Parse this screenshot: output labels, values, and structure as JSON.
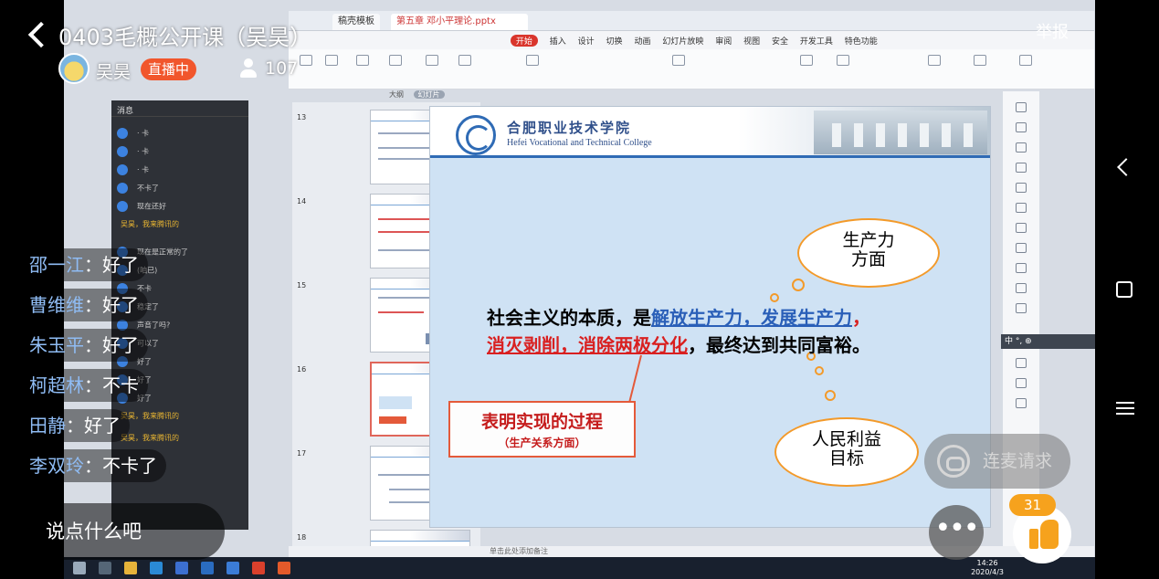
{
  "stream": {
    "title": "0403毛概公开课（吴昊）",
    "host_name": "吴昊",
    "live_badge": "直播中",
    "viewer_count": "107",
    "report_label": "举报"
  },
  "comments": [
    {
      "user": "邵一江",
      "text": "：好了"
    },
    {
      "user": "曹维维",
      "text": "：好了"
    },
    {
      "user": "朱玉平",
      "text": "：好了"
    },
    {
      "user": "柯超林",
      "text": "：不卡"
    },
    {
      "user": "田静",
      "text": "：好了"
    },
    {
      "user": "李双玲",
      "text": "：不卡了"
    }
  ],
  "input": {
    "placeholder": "说点什么吧"
  },
  "actions": {
    "cohost_label": "连麦请求",
    "like_count": "31"
  },
  "shared_screen": {
    "ppt_tab_home": "稿壳模板",
    "ppt_tab_doc": "第五章  邓小平理论.pptx",
    "ribbon_menu": [
      "开始",
      "插入",
      "设计",
      "切换",
      "动画",
      "幻灯片放映",
      "审阅",
      "视图",
      "安全",
      "开发工具",
      "特色功能"
    ],
    "subtabs": [
      "大纲",
      "幻灯片"
    ],
    "thumb_numbers": [
      "13",
      "14",
      "15",
      "16",
      "17",
      "18"
    ],
    "msg_panel_head": "消息",
    "notes_hint": "单击此处添加备注",
    "lang_bar": "中 °, ⊕",
    "clock_time": "14:26",
    "clock_date": "2020/4/3"
  },
  "slide": {
    "college_cn": "合肥职业技术学院",
    "college_en": "Hefei Vocational and Technical College",
    "cloud_top": [
      "生产力",
      "方面"
    ],
    "cloud_bottom": [
      "人民利益",
      "目标"
    ],
    "line1_prefix": "社会主义的本质，是",
    "line1_highlight": "解放生产力，发展生产力",
    "line1_suffix": "，",
    "line2_highlight": "消灭剥削，消除两极分化",
    "line2_suffix": "，最终达到共同富裕。",
    "process_title": "表明实现的过程",
    "process_sub": "（生产关系方面）"
  },
  "colors": {
    "live_badge": "#f1562c",
    "like": "#f6a21d",
    "comment_user": "#8fbcf4",
    "slide_blue": "#2a5fb8",
    "slide_red": "#d92020"
  }
}
